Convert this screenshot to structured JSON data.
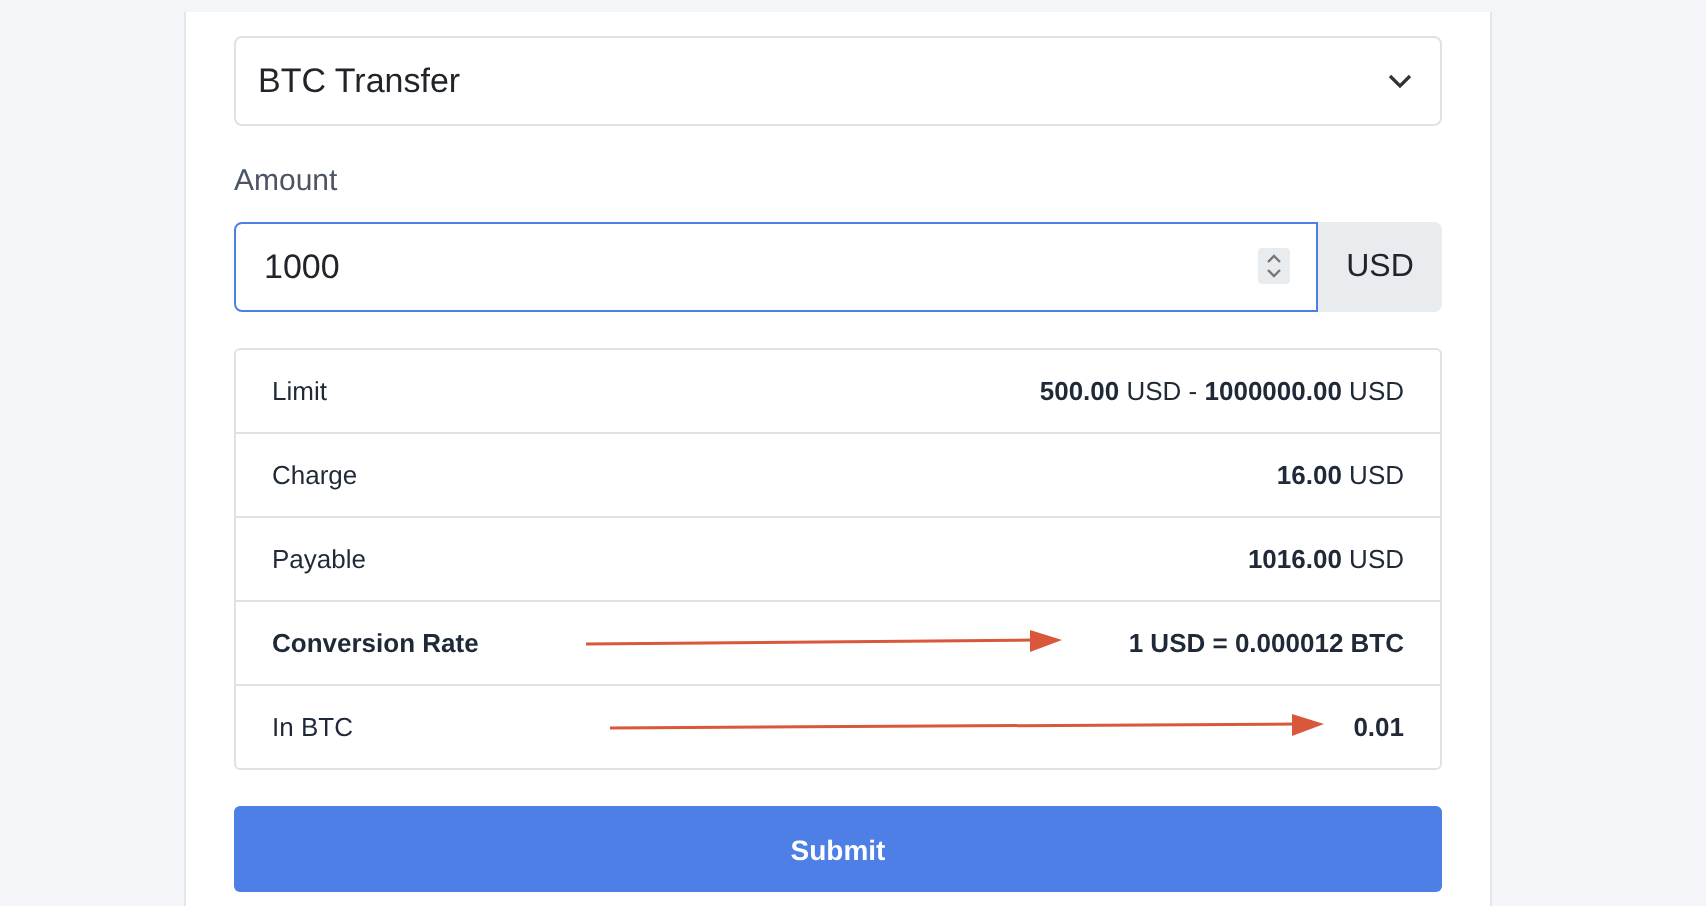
{
  "method_select": {
    "value": "BTC Transfer"
  },
  "amount": {
    "label": "Amount",
    "value": "1000",
    "focused": true,
    "currency": "USD"
  },
  "summary": [
    {
      "label": "Limit",
      "value": "**500.00** USD - **1000000.00** USD",
      "emphasis": false,
      "arrow": false
    },
    {
      "label": "Charge",
      "value": "**16.00** USD",
      "emphasis": false,
      "arrow": false
    },
    {
      "label": "Payable",
      "value": "**1016.00** USD",
      "emphasis": false,
      "arrow": false
    },
    {
      "label": "Conversion Rate",
      "value": "1 USD = 0.000012 BTC",
      "emphasis": true,
      "arrow": true
    },
    {
      "label": "In BTC",
      "value": "**0.01**",
      "emphasis": false,
      "arrow": true
    }
  ],
  "submit": {
    "label": "Submit"
  }
}
